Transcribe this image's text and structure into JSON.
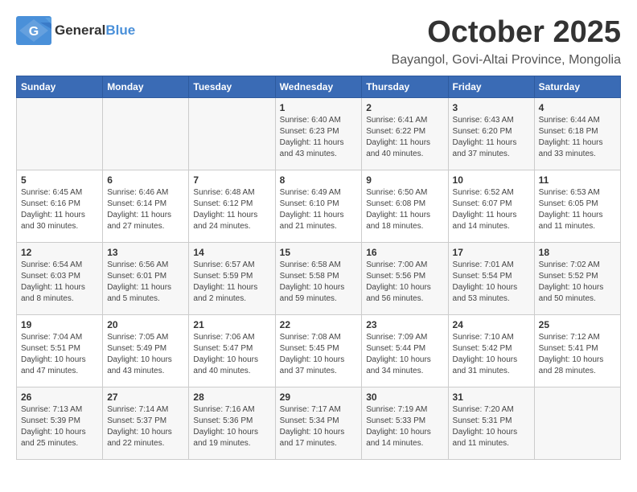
{
  "header": {
    "logo_general": "General",
    "logo_blue": "Blue",
    "month": "October 2025",
    "location": "Bayangol, Govi-Altai Province, Mongolia"
  },
  "days_of_week": [
    "Sunday",
    "Monday",
    "Tuesday",
    "Wednesday",
    "Thursday",
    "Friday",
    "Saturday"
  ],
  "weeks": [
    [
      {
        "day": "",
        "info": ""
      },
      {
        "day": "",
        "info": ""
      },
      {
        "day": "",
        "info": ""
      },
      {
        "day": "1",
        "info": "Sunrise: 6:40 AM\nSunset: 6:23 PM\nDaylight: 11 hours and 43 minutes."
      },
      {
        "day": "2",
        "info": "Sunrise: 6:41 AM\nSunset: 6:22 PM\nDaylight: 11 hours and 40 minutes."
      },
      {
        "day": "3",
        "info": "Sunrise: 6:43 AM\nSunset: 6:20 PM\nDaylight: 11 hours and 37 minutes."
      },
      {
        "day": "4",
        "info": "Sunrise: 6:44 AM\nSunset: 6:18 PM\nDaylight: 11 hours and 33 minutes."
      }
    ],
    [
      {
        "day": "5",
        "info": "Sunrise: 6:45 AM\nSunset: 6:16 PM\nDaylight: 11 hours and 30 minutes."
      },
      {
        "day": "6",
        "info": "Sunrise: 6:46 AM\nSunset: 6:14 PM\nDaylight: 11 hours and 27 minutes."
      },
      {
        "day": "7",
        "info": "Sunrise: 6:48 AM\nSunset: 6:12 PM\nDaylight: 11 hours and 24 minutes."
      },
      {
        "day": "8",
        "info": "Sunrise: 6:49 AM\nSunset: 6:10 PM\nDaylight: 11 hours and 21 minutes."
      },
      {
        "day": "9",
        "info": "Sunrise: 6:50 AM\nSunset: 6:08 PM\nDaylight: 11 hours and 18 minutes."
      },
      {
        "day": "10",
        "info": "Sunrise: 6:52 AM\nSunset: 6:07 PM\nDaylight: 11 hours and 14 minutes."
      },
      {
        "day": "11",
        "info": "Sunrise: 6:53 AM\nSunset: 6:05 PM\nDaylight: 11 hours and 11 minutes."
      }
    ],
    [
      {
        "day": "12",
        "info": "Sunrise: 6:54 AM\nSunset: 6:03 PM\nDaylight: 11 hours and 8 minutes."
      },
      {
        "day": "13",
        "info": "Sunrise: 6:56 AM\nSunset: 6:01 PM\nDaylight: 11 hours and 5 minutes."
      },
      {
        "day": "14",
        "info": "Sunrise: 6:57 AM\nSunset: 5:59 PM\nDaylight: 11 hours and 2 minutes."
      },
      {
        "day": "15",
        "info": "Sunrise: 6:58 AM\nSunset: 5:58 PM\nDaylight: 10 hours and 59 minutes."
      },
      {
        "day": "16",
        "info": "Sunrise: 7:00 AM\nSunset: 5:56 PM\nDaylight: 10 hours and 56 minutes."
      },
      {
        "day": "17",
        "info": "Sunrise: 7:01 AM\nSunset: 5:54 PM\nDaylight: 10 hours and 53 minutes."
      },
      {
        "day": "18",
        "info": "Sunrise: 7:02 AM\nSunset: 5:52 PM\nDaylight: 10 hours and 50 minutes."
      }
    ],
    [
      {
        "day": "19",
        "info": "Sunrise: 7:04 AM\nSunset: 5:51 PM\nDaylight: 10 hours and 47 minutes."
      },
      {
        "day": "20",
        "info": "Sunrise: 7:05 AM\nSunset: 5:49 PM\nDaylight: 10 hours and 43 minutes."
      },
      {
        "day": "21",
        "info": "Sunrise: 7:06 AM\nSunset: 5:47 PM\nDaylight: 10 hours and 40 minutes."
      },
      {
        "day": "22",
        "info": "Sunrise: 7:08 AM\nSunset: 5:45 PM\nDaylight: 10 hours and 37 minutes."
      },
      {
        "day": "23",
        "info": "Sunrise: 7:09 AM\nSunset: 5:44 PM\nDaylight: 10 hours and 34 minutes."
      },
      {
        "day": "24",
        "info": "Sunrise: 7:10 AM\nSunset: 5:42 PM\nDaylight: 10 hours and 31 minutes."
      },
      {
        "day": "25",
        "info": "Sunrise: 7:12 AM\nSunset: 5:41 PM\nDaylight: 10 hours and 28 minutes."
      }
    ],
    [
      {
        "day": "26",
        "info": "Sunrise: 7:13 AM\nSunset: 5:39 PM\nDaylight: 10 hours and 25 minutes."
      },
      {
        "day": "27",
        "info": "Sunrise: 7:14 AM\nSunset: 5:37 PM\nDaylight: 10 hours and 22 minutes."
      },
      {
        "day": "28",
        "info": "Sunrise: 7:16 AM\nSunset: 5:36 PM\nDaylight: 10 hours and 19 minutes."
      },
      {
        "day": "29",
        "info": "Sunrise: 7:17 AM\nSunset: 5:34 PM\nDaylight: 10 hours and 17 minutes."
      },
      {
        "day": "30",
        "info": "Sunrise: 7:19 AM\nSunset: 5:33 PM\nDaylight: 10 hours and 14 minutes."
      },
      {
        "day": "31",
        "info": "Sunrise: 7:20 AM\nSunset: 5:31 PM\nDaylight: 10 hours and 11 minutes."
      },
      {
        "day": "",
        "info": ""
      }
    ]
  ]
}
